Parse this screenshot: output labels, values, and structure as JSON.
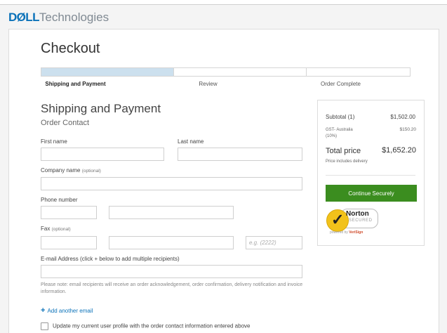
{
  "brand": {
    "dell": "DØLL",
    "technologies": "Technologies"
  },
  "page": {
    "title": "Checkout"
  },
  "steps": [
    {
      "label": "Shipping and Payment",
      "active": true
    },
    {
      "label": "Review",
      "active": false
    },
    {
      "label": "Order Complete",
      "active": false
    }
  ],
  "progress": {
    "completed_steps": 1,
    "total_steps": 3
  },
  "section": {
    "heading": "Shipping and Payment",
    "subheading": "Order Contact"
  },
  "form": {
    "first_name_label": "First name",
    "last_name_label": "Last name",
    "company_label": "Company name",
    "company_optional": "(optional)",
    "phone_label": "Phone number",
    "fax_label": "Fax",
    "fax_optional": "(optional)",
    "fax_ext_placeholder": "e.g. (2222)",
    "email_label": "E-mail Address (click + below to add multiple recipients)",
    "note": "Please note: email recipients will receive an order acknowledgement, order confirmation, delivery notification and invoice information.",
    "add_email_icon": "plus-icon",
    "add_email": "Add another email",
    "update_profile": "Update my current user profile with the order contact information entered above"
  },
  "summary": {
    "subtotal_label": "Subtotal (1)",
    "subtotal_value": "$1,502.00",
    "gst_label_line1": "GST- Australia",
    "gst_label_line2": "(10%)",
    "gst_value": "$150.20",
    "total_label": "Total price",
    "total_value": "$1,652.20",
    "delivery_note": "Price includes delivery",
    "cta": "Continue Securely"
  },
  "norton": {
    "name": "Norton",
    "secured": "SECURED",
    "powered_by": "powered by",
    "verisign": "VeriSign"
  },
  "colors": {
    "dell_blue": "#0b72b9",
    "cta_green": "#3b8d1f",
    "progress_fill": "#cce0ee",
    "norton_yellow": "#f2c21b"
  }
}
